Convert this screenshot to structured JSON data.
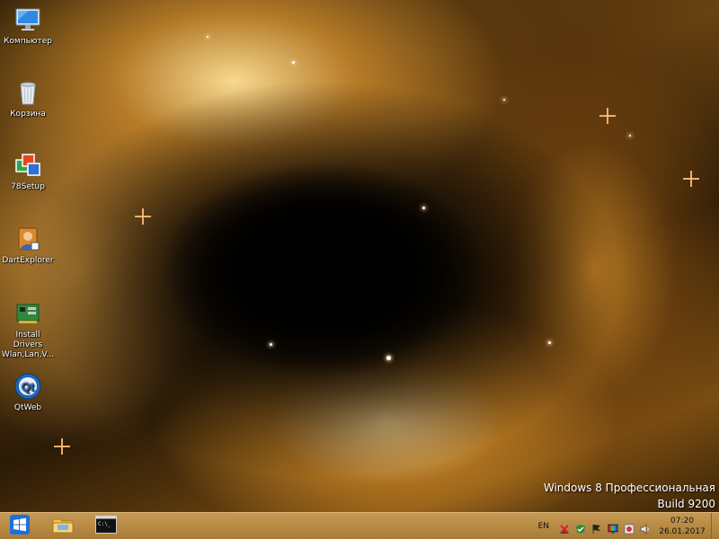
{
  "desktop": {
    "icons": [
      {
        "label": "Компьютер",
        "icon": "computer-icon"
      },
      {
        "label": "Корзина",
        "icon": "recycle-bin-icon"
      },
      {
        "label": "78Setup",
        "icon": "setup-icon"
      },
      {
        "label": "DartExplorer",
        "icon": "dart-explorer-icon"
      },
      {
        "label": "Install Drivers\nWlan,Lan,V...",
        "icon": "drivers-icon"
      },
      {
        "label": "QtWeb",
        "icon": "qtweb-icon"
      }
    ],
    "watermark": {
      "line1": "Windows 8 Профессиональная",
      "line2": "Build 9200"
    }
  },
  "taskbar": {
    "start_icon": "windows-logo-icon",
    "pinned": [
      {
        "name": "file-explorer-icon"
      },
      {
        "name": "command-prompt-icon"
      }
    ],
    "tray": {
      "language": "EN",
      "icons": [
        "network-error-icon",
        "security-icon",
        "flag-icon",
        "display-icon",
        "usb-icon",
        "volume-icon"
      ],
      "time": "07:20",
      "date": "26.01.2017"
    }
  },
  "colors": {
    "taskbar": "#b88a45",
    "accent": "#1e6fd9"
  }
}
